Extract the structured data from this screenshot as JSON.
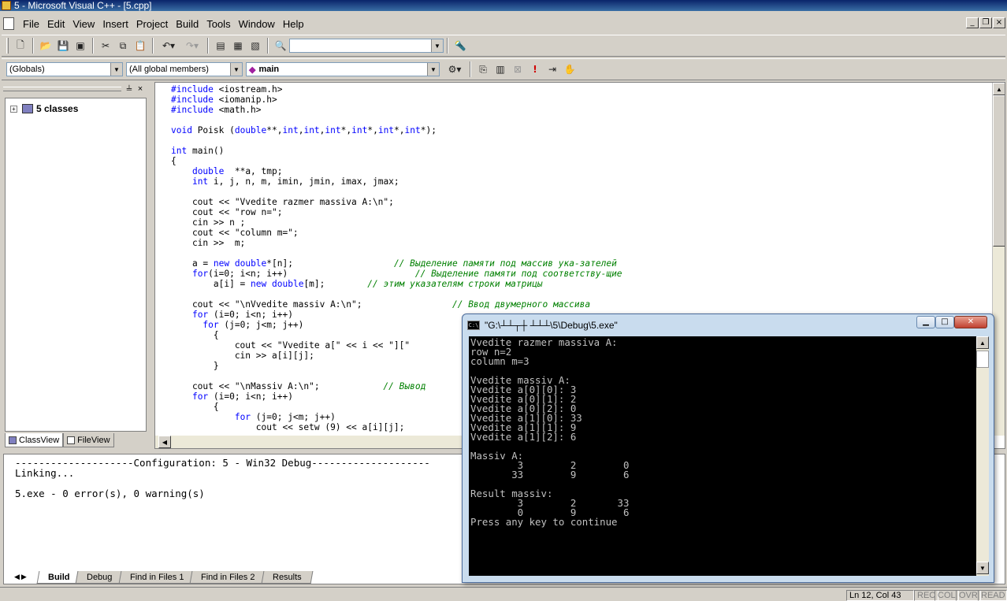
{
  "window": {
    "title": "5 - Microsoft Visual C++ - [5.cpp]"
  },
  "menu": [
    "File",
    "Edit",
    "View",
    "Insert",
    "Project",
    "Build",
    "Tools",
    "Window",
    "Help"
  ],
  "toolbar2": {
    "scope_combo": "(Globals)",
    "members_combo": "(All global members)",
    "function_combo": "main"
  },
  "classview": {
    "root": "5 classes",
    "tabs": [
      "ClassView",
      "FileView"
    ]
  },
  "editor": {
    "lines": [
      "#include <iostream.h>",
      "#include <iomanip.h>",
      "#include <math.h>",
      "",
      "void Poisk (double**,int,int,int*,int*,int*,int*);",
      "",
      "int main()",
      "{",
      "    double  **a, tmp;",
      "    int i, j, n, m, imin, jmin, imax, jmax;",
      "",
      "    cout << \"Vvedite razmer massiva A:\\n\";",
      "    cout << \"row n=\";",
      "    cin >> n ;",
      "    cout << \"column m=\";",
      "    cin >>  m;",
      "",
      "    a = new double*[n];                   // Выделение памяти под массив ука-зателей",
      "    for(i=0; i<n; i++)                        // Выделение памяти под соответству-щие",
      "        a[i] = new double[m];        // этим указателям строки матрицы",
      "",
      "    cout << \"\\nVvedite massiv A:\\n\";                 // Ввод двумерного массива",
      "    for (i=0; i<n; i++)",
      "      for (j=0; j<m; j++)",
      "        {",
      "            cout << \"Vvedite a[\" << i << \"][\"",
      "            cin >> a[i][j];",
      "        }",
      "",
      "    cout << \"\\nMassiv A:\\n\";            // Вывод",
      "    for (i=0; i<n; i++)",
      "        {",
      "            for (j=0; j<m; j++)",
      "                cout << setw (9) << a[i][j];"
    ]
  },
  "output": {
    "lines": [
      "--------------------Configuration: 5 - Win32 Debug--------------------",
      "Linking...",
      "",
      "5.exe - 0 error(s), 0 warning(s)"
    ],
    "tabs": [
      "Build",
      "Debug",
      "Find in Files 1",
      "Find in Files 2",
      "Results"
    ]
  },
  "statusbar": {
    "position": "Ln 12, Col 43",
    "flags": [
      "REC",
      "COL",
      "OVR",
      "READ"
    ]
  },
  "console": {
    "title": "\"G:\\┴┴┬┼ ┴┴┴\\5\\Debug\\5.exe\"",
    "lines": [
      "Vvedite razmer massiva A:",
      "row n=2",
      "column m=3",
      "",
      "Vvedite massiv A:",
      "Vvedite a[0][0]: 3",
      "Vvedite a[0][1]: 2",
      "Vvedite a[0][2]: 0",
      "Vvedite a[1][0]: 33",
      "Vvedite a[1][1]: 9",
      "Vvedite a[1][2]: 6",
      "",
      "Massiv A:",
      "        3        2        0",
      "       33        9        6",
      "",
      "Result massiv:",
      "        3        2       33",
      "        0        9        6",
      "Press any key to continue"
    ]
  }
}
